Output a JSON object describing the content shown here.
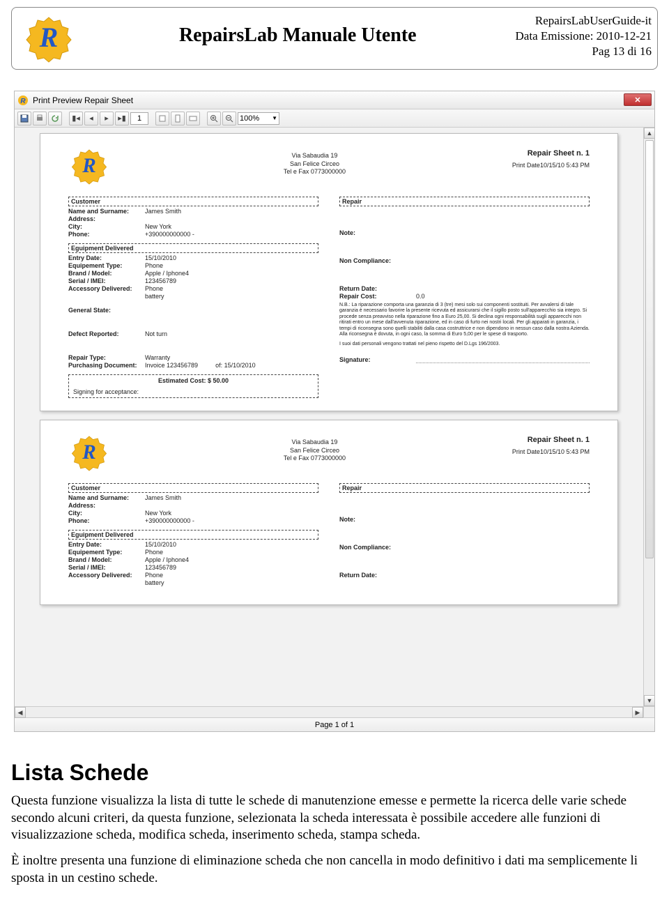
{
  "header": {
    "title": "RepairsLab Manuale Utente",
    "doc_id": "RepairsLabUserGuide-it",
    "date_label": "Data Emissione: 2010-12-21",
    "page_label": "Pag 13 di 16"
  },
  "window": {
    "title": "Print Preview Repair Sheet",
    "page_field": "1",
    "zoom": "100%",
    "status": "Page 1 of 1"
  },
  "sheet": {
    "company": {
      "line1": "Via Sabaudia 19",
      "line2": "San Felice Circeo",
      "line3": "Tel e Fax 0773000000"
    },
    "top_right": {
      "title": "Repair Sheet n. 1",
      "print_date": "Print Date10/15/10 5:43 PM"
    },
    "customer": {
      "section": "Customer",
      "name_k": "Name and Surname:",
      "name_v": "James Smith",
      "address_k": "Address:",
      "address_v": "",
      "city_k": "City:",
      "city_v": "New York",
      "phone_k": "Phone:",
      "phone_v": "+390000000000 -"
    },
    "equipment": {
      "section": "Eguipment Delivered",
      "entry_k": "Entry Date:",
      "entry_v": "15/10/2010",
      "type_k": "Equipement Type:",
      "type_v": "Phone",
      "brand_k": "Brand / Model:",
      "brand_v": "Apple / Iphone4",
      "serial_k": "Serial / IMEI:",
      "serial_v": "123456789",
      "acc_k": "Accessory Delivered:",
      "acc_v1": "Phone",
      "acc_v2": "battery"
    },
    "general_state_k": "General State:",
    "general_state_v": "",
    "defect_k": "Defect Reported:",
    "defect_v": "Not turn",
    "repair_type_k": "Repair Type:",
    "repair_type_v": "Warranty",
    "purch_k": "Purchasing Document:",
    "purch_v": "Invoice  123456789",
    "purch_of_k": "of:",
    "purch_of_v": "15/10/2010",
    "est_cost_label": "Estimated Cost: $ 50.00",
    "signing_label": "Signing for acceptance:",
    "right": {
      "repair_section": "Repair",
      "note_k": "Note:",
      "noncomp_k": "Non Compliance:",
      "return_k": "Return Date:",
      "cost_k": "Repair Cost:",
      "cost_v": "0.0",
      "legal1": "N.B.: La riparazione comporta una garanzia di 3 (tre) mesi solo sui componenti sostituiti. Per avvalersi di tale garanzia è necessario favorire la presente ricevuta ed assicurarsi che il sigillo posto sull'apparecchio sia integro. Si procede senza preavviso nella riparazione fino a Euro 25,00. Si declina ogni responsabilità sugli apparecchi non ritirati entro un mese dall'avvenuta riparazione, ed in caso di furto nei nostri locali. Per gli apparati in garanzia, i tempi di riconsegna sono quelli stabiliti dalla casa costruttrice e non dipendono in nessun caso dalla nostra Azienda. Alla riconsegna è dovuta, in ogni caso, la somma di Euro 5,00 per le spese di trasporto.",
      "legal2": "I suoi dati personali vengono trattati nel pieno rispetto del D.Lgs 196/2003.",
      "signature_k": "Signature:"
    }
  },
  "body": {
    "h2": "Lista Schede",
    "p1": "Questa funzione visualizza la lista di tutte le schede di manutenzione emesse e permette la ricerca delle varie schede secondo alcuni criteri, da questa funzione, selezionata la scheda interessata è possibile accedere alle funzioni di visualizzazione scheda, modifica scheda, inserimento scheda, stampa scheda.",
    "p2": "È inoltre presenta una funzione di eliminazione scheda che non cancella in modo definitivo i dati ma semplicemente li sposta in un cestino schede."
  }
}
